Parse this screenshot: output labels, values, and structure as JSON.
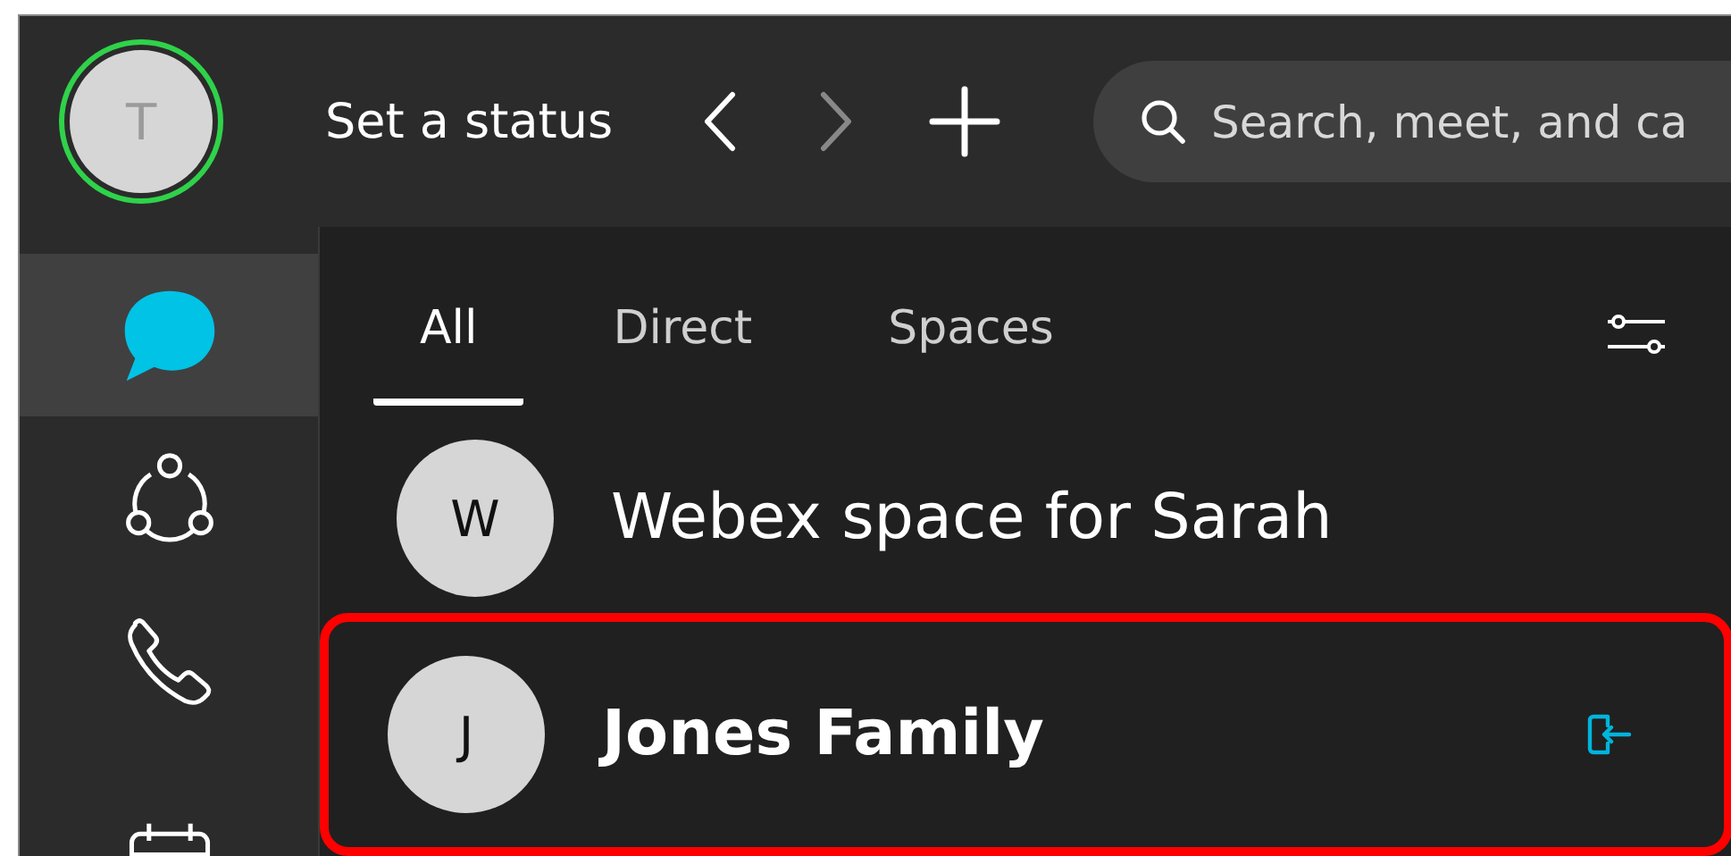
{
  "header": {
    "avatar": {
      "initial": "T",
      "online": true
    },
    "status": "Set a status",
    "back_enabled": true,
    "forward_enabled": false,
    "search": {
      "placeholder": "Search, meet, and ca"
    }
  },
  "sidebar": {
    "items": [
      {
        "kind": "messaging",
        "selected": true
      },
      {
        "kind": "teams",
        "selected": false
      },
      {
        "kind": "calling",
        "selected": false
      },
      {
        "kind": "meetings",
        "selected": false
      }
    ]
  },
  "tabs": [
    {
      "label": "All",
      "selected": true
    },
    {
      "label": "Direct",
      "selected": false
    },
    {
      "label": "Spaces",
      "selected": false
    }
  ],
  "spaces": [
    {
      "initial": "W",
      "name": "Webex space for Sarah",
      "bold": false,
      "highlighted": false,
      "join_action": false
    },
    {
      "initial": "J",
      "name": "Jones Family",
      "bold": true,
      "highlighted": true,
      "join_action": true
    }
  ]
}
